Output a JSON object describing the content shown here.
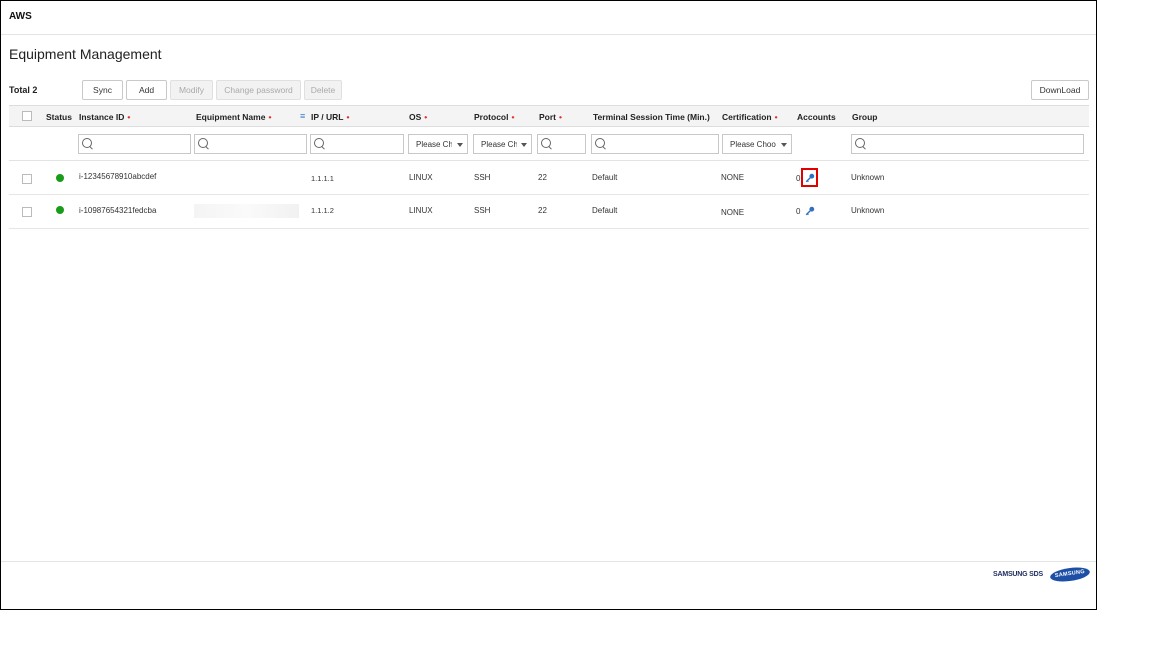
{
  "app": {
    "title": "AWS"
  },
  "page": {
    "title": "Equipment Management"
  },
  "toolbar": {
    "total": "Total 2",
    "sync": "Sync",
    "add": "Add",
    "modify": "Modify",
    "change_password": "Change password",
    "delete": "Delete",
    "download": "DownLoad"
  },
  "columns": {
    "status": "Status",
    "instance_id": "Instance ID",
    "equipment_name": "Equipment Name",
    "ip_url": "IP / URL",
    "os": "OS",
    "protocol": "Protocol",
    "port": "Port",
    "terminal_session_time": "Terminal Session Time (Min.)",
    "certification": "Certification",
    "accounts": "Accounts",
    "group": "Group",
    "required_mark": "•"
  },
  "filters": {
    "os_select": "Please Choose",
    "protocol_select": "Please Choose",
    "certification_select": "Please Choose"
  },
  "rows": [
    {
      "instance_id": "i-12345678910abcdef",
      "ip": "1.1.1.1",
      "os": "LINUX",
      "protocol": "SSH",
      "port": "22",
      "session_time": "Default",
      "certification": "NONE",
      "accounts": "0",
      "group": "Unknown",
      "status_color": "#1a9b1a"
    },
    {
      "instance_id": "i-10987654321fedcba",
      "ip": "1.1.1.2",
      "os": "LINUX",
      "protocol": "SSH",
      "port": "22",
      "session_time": "Default",
      "certification": "NONE",
      "accounts": "0",
      "group": "Unknown",
      "status_color": "#1a9b1a"
    }
  ],
  "footer": {
    "brand": "SAMSUNG SDS",
    "logo": "SAMSUNG"
  },
  "colors": {
    "highlight": "#e00000",
    "status_ok": "#1a9b1a",
    "key_icon": "#2f6fc4"
  }
}
